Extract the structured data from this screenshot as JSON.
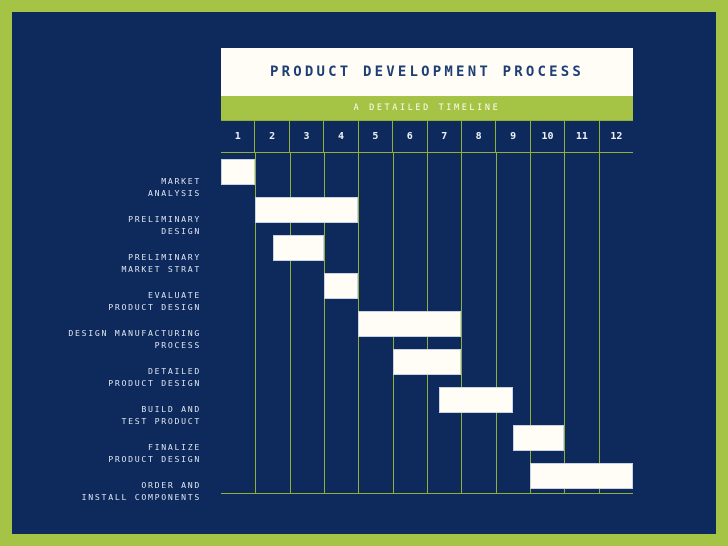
{
  "theme": {
    "border_green": "#a5c445",
    "panel_navy": "#0e2a5c",
    "bar_cream": "#fffdf5",
    "grid_line": "#8fb13a",
    "title_color": "#1d3f75"
  },
  "header": {
    "title": "PRODUCT DEVELOPMENT PROCESS",
    "subtitle": "A DETAILED TIMELINE"
  },
  "chart_data": {
    "type": "bar",
    "title": "PRODUCT DEVELOPMENT PROCESS",
    "subtitle": "A DETAILED TIMELINE",
    "xlabel": "",
    "ylabel": "",
    "xlim": [
      1,
      13
    ],
    "grid": true,
    "legend": "none",
    "categories": [
      "1",
      "2",
      "3",
      "4",
      "5",
      "6",
      "7",
      "8",
      "9",
      "10",
      "11",
      "12"
    ],
    "tasks": [
      {
        "label_line1": "MARKET",
        "label_line2": "ANALYSIS",
        "start": 1.0,
        "end": 2.0
      },
      {
        "label_line1": "PRELIMINARY",
        "label_line2": "DESIGN",
        "start": 2.0,
        "end": 5.0
      },
      {
        "label_line1": "PRELIMINARY",
        "label_line2": "MARKET STRAT",
        "start": 2.5,
        "end": 4.0
      },
      {
        "label_line1": "EVALUATE",
        "label_line2": "PRODUCT DESIGN",
        "start": 4.0,
        "end": 5.0
      },
      {
        "label_line1": "DESIGN MANUFACTURING",
        "label_line2": "PROCESS",
        "start": 5.0,
        "end": 8.0
      },
      {
        "label_line1": "DETAILED",
        "label_line2": "PRODUCT DESIGN",
        "start": 6.0,
        "end": 8.0
      },
      {
        "label_line1": "BUILD AND",
        "label_line2": "TEST PRODUCT",
        "start": 7.35,
        "end": 9.5
      },
      {
        "label_line1": "FINALIZE",
        "label_line2": "PRODUCT DESIGN",
        "start": 9.5,
        "end": 11.0
      },
      {
        "label_line1": "ORDER AND",
        "label_line2": "INSTALL COMPONENTS",
        "start": 10.0,
        "end": 13.0
      }
    ]
  }
}
